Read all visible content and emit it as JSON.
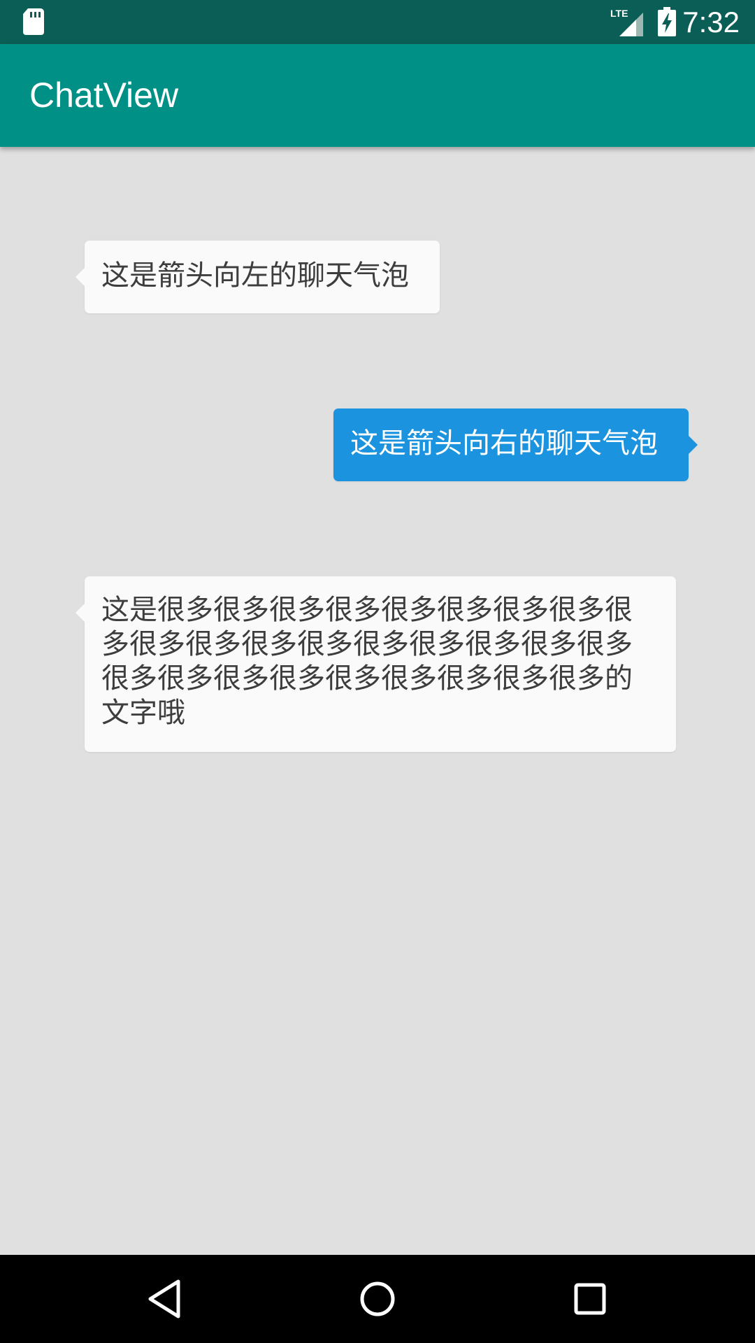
{
  "status_bar": {
    "time": "7:32",
    "network_label": "LTE",
    "icons": [
      "sd-card-icon",
      "lte-signal-icon",
      "battery-charging-icon"
    ]
  },
  "app_bar": {
    "title": "ChatView"
  },
  "messages": [
    {
      "direction": "left",
      "text": "这是箭头向左的聊天气泡"
    },
    {
      "direction": "right",
      "text": "这是箭头向右的聊天气泡"
    },
    {
      "direction": "left",
      "text": "这是很多很多很多很多很多很多很多很多很多很多很多很多很多很多很多很多很多很多很多很多很多很多很多很多很多很多很多的文字哦"
    }
  ],
  "nav_bar": {
    "icons": [
      "back-icon",
      "home-icon",
      "recents-icon"
    ]
  },
  "colors": {
    "status_bar": "#0b5e55",
    "app_bar": "#009085",
    "background": "#e0e0e0",
    "bubble_left": "#fafafa",
    "bubble_right": "#1b93df",
    "nav_bar": "#000000"
  }
}
